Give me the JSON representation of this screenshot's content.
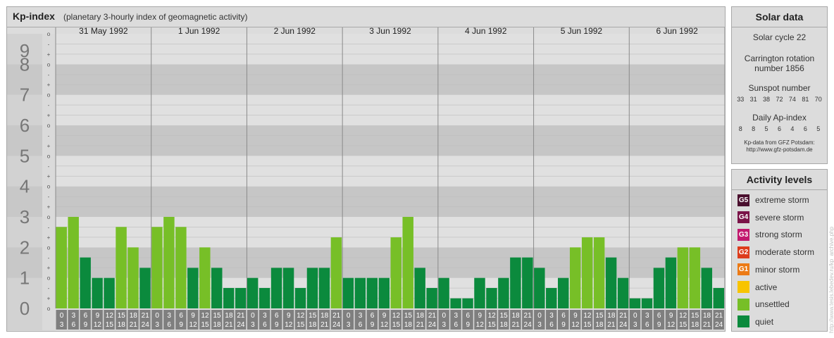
{
  "header": {
    "title": "Kp-index",
    "subtitle": "(planetary 3-hourly index of geomagnetic activity)"
  },
  "chart_data": {
    "type": "bar",
    "y_labels": [
      "0",
      "1",
      "2",
      "3",
      "4",
      "5",
      "6",
      "7",
      "8",
      "9"
    ],
    "sub_marks": [
      "o",
      "+",
      "-"
    ],
    "ylim": [
      0,
      9
    ],
    "days": [
      {
        "label": "31 May 1992",
        "values": [
          2.67,
          3.0,
          1.67,
          1.0,
          1.0,
          2.67,
          2.0,
          1.33
        ]
      },
      {
        "label": "1 Jun 1992",
        "values": [
          2.67,
          3.0,
          2.67,
          1.33,
          2.0,
          1.33,
          0.67,
          0.67
        ]
      },
      {
        "label": "2 Jun 1992",
        "values": [
          1.0,
          0.67,
          1.33,
          1.33,
          0.67,
          1.33,
          1.33,
          2.33
        ]
      },
      {
        "label": "3 Jun 1992",
        "values": [
          1.0,
          1.0,
          1.0,
          1.0,
          2.33,
          3.0,
          1.33,
          0.67
        ]
      },
      {
        "label": "4 Jun 1992",
        "values": [
          1.0,
          0.33,
          0.33,
          1.0,
          0.67,
          1.0,
          1.67,
          1.67
        ]
      },
      {
        "label": "5 Jun 1992",
        "values": [
          1.33,
          0.67,
          1.0,
          2.0,
          2.33,
          2.33,
          1.67,
          1.0
        ]
      },
      {
        "label": "6 Jun 1992",
        "values": [
          0.33,
          0.33,
          1.33,
          1.67,
          2.0,
          2.0,
          1.33,
          0.67
        ]
      }
    ],
    "hour_ticks": [
      [
        "0",
        "3"
      ],
      [
        "3",
        "6"
      ],
      [
        "6",
        "9"
      ],
      [
        "9",
        "12"
      ],
      [
        "12",
        "15"
      ],
      [
        "15",
        "18"
      ],
      [
        "18",
        "21"
      ],
      [
        "21",
        "24"
      ]
    ],
    "colors": {
      "quiet": "#0b8a3d",
      "unsettled": "#77bf27",
      "band_dark": "#c6c6c6",
      "band_light": "#e0e0e0",
      "axis_bg": "#d2d2d2",
      "number_bg": "#c8c8c8",
      "number_fg": "#777777",
      "tick_bg": "#7f7f7f"
    }
  },
  "solar": {
    "title": "Solar data",
    "cycle": "Solar cycle 22",
    "carrington_line1": "Carrington rotation",
    "carrington_line2": "number 1856",
    "sunspot_title": "Sunspot number",
    "sunspot_values": [
      "33",
      "31",
      "38",
      "72",
      "74",
      "81",
      "70"
    ],
    "ap_title": "Daily Ap-index",
    "ap_values": [
      "8",
      "8",
      "5",
      "6",
      "4",
      "6",
      "5"
    ],
    "credit_line1": "Kp-data from GFZ Potsdam:",
    "credit_line2": "http://www.gfz-potsdam.de"
  },
  "activity": {
    "title": "Activity levels",
    "items": [
      {
        "code": "G5",
        "label": "extreme storm",
        "color": "#4a0f2e"
      },
      {
        "code": "G4",
        "label": "severe storm",
        "color": "#7a1348"
      },
      {
        "code": "G3",
        "label": "strong storm",
        "color": "#c2186e"
      },
      {
        "code": "G2",
        "label": "moderate storm",
        "color": "#dd3c1c"
      },
      {
        "code": "G1",
        "label": "minor storm",
        "color": "#ec7a15"
      },
      {
        "code": "",
        "label": "active",
        "color": "#f8c400"
      },
      {
        "code": "",
        "label": "unsettled",
        "color": "#77bf27"
      },
      {
        "code": "",
        "label": "quiet",
        "color": "#0b8a3d"
      }
    ]
  },
  "watermark": "http://www.tesis.lebedev.ru/kp_archive.php"
}
